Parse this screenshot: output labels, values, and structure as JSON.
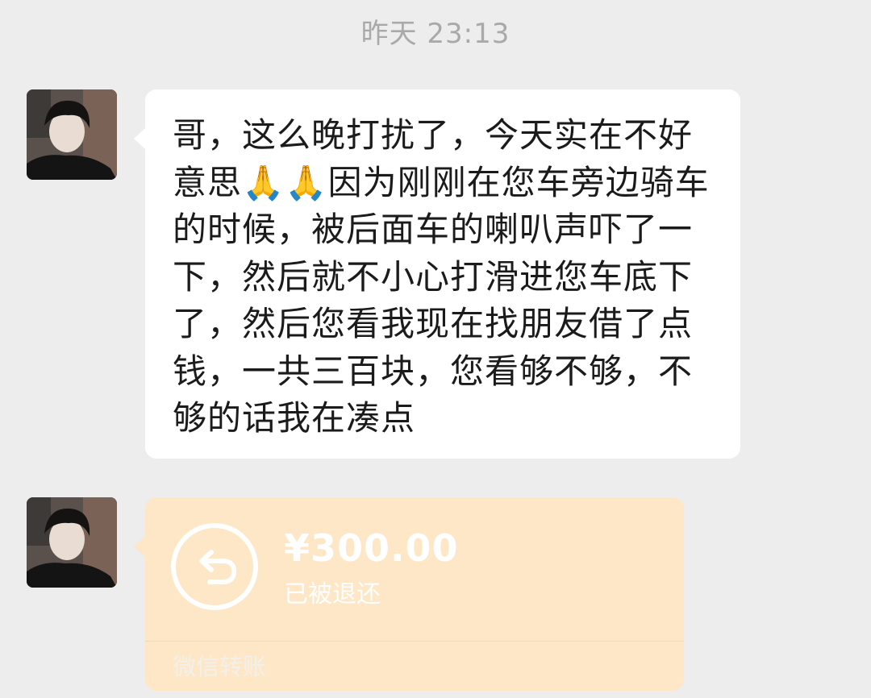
{
  "chat": {
    "timestamp": "昨天 23:13",
    "messages": [
      {
        "type": "text",
        "text": "哥，这么晚打扰了，今天实在不好意思🙏🙏因为刚刚在您车旁边骑车的时候，被后面车的喇叭声吓了一下，然后就不小心打滑进您车底下了，然后您看我现在找朋友借了点钱，一共三百块，您看够不够，不够的话我在凑点"
      },
      {
        "type": "transfer",
        "amount": "¥300.00",
        "status": "已被退还",
        "label": "微信转账",
        "icon": "return-arrow-icon"
      }
    ]
  },
  "colors": {
    "background": "#ededed",
    "bubble": "#ffffff",
    "transfer_card": "#fde7c6"
  }
}
